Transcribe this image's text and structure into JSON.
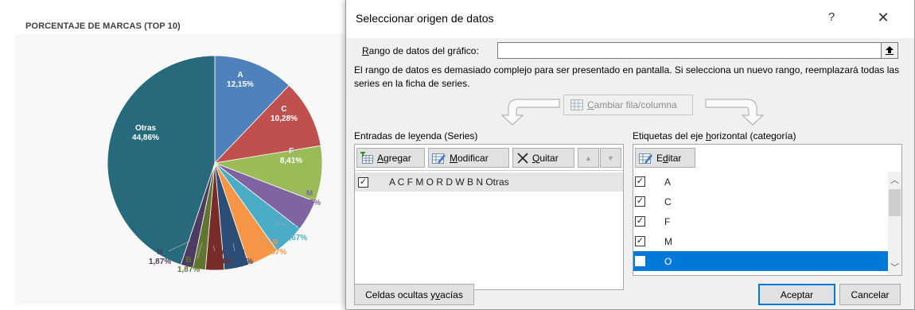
{
  "chart_data": {
    "type": "pie",
    "title": "PORCENTAJE DE MARCAS  (TOP 10)",
    "slices": [
      {
        "label": "A",
        "pct": "12,15%",
        "value": 12.15,
        "color": "#4f81bd",
        "label_color": "#ffffff"
      },
      {
        "label": "C",
        "pct": "10,28%",
        "value": 10.28,
        "color": "#c0504d",
        "label_color": "#ffffff"
      },
      {
        "label": "F",
        "pct": "8,41%",
        "value": 8.41,
        "color": "#9bbb59",
        "label_color": "#ffffff"
      },
      {
        "label": "M",
        "pct": "4,67%",
        "value": 4.67,
        "color": "#8064a2",
        "label_color": "#8064a2"
      },
      {
        "label": "O",
        "pct": "4,67%",
        "value": 4.67,
        "color": "#4bacc6",
        "label_color": "#4bacc6"
      },
      {
        "label": "R",
        "pct": "4,67%",
        "value": 4.67,
        "color": "#f79646",
        "label_color": "#f79646"
      },
      {
        "label": "D",
        "pct": "3,74%",
        "value": 3.74,
        "color": "#2c4d75",
        "label_color": "#2c4d75"
      },
      {
        "label": "W",
        "pct": "2,80%",
        "value": 2.8,
        "color": "#772c2a",
        "label_color": "#772c2a"
      },
      {
        "label": "B",
        "pct": "1,87%",
        "value": 1.87,
        "color": "#5f7530",
        "label_color": "#5f7530"
      },
      {
        "label": "N",
        "pct": "1,87%",
        "value": 1.87,
        "color": "#4d3b62",
        "label_color": "#4d3b62"
      },
      {
        "label": "Otras",
        "pct": "44,86%",
        "value": 44.86,
        "color": "#276a7c",
        "label_color": "#ffffff"
      }
    ]
  },
  "dialog": {
    "title": "Seleccionar origen de datos",
    "help_glyph": "?",
    "close_glyph": "✕",
    "range_label_pre": "",
    "range_label_u": "R",
    "range_label_post": "ango de datos del gráfico:",
    "range_value": "",
    "info_text": "El rango de datos es demasiado complejo para ser presentado en pantalla. Si selecciona un nuevo rango, reemplazará todas las series en la ficha de series.",
    "switch_pre": "",
    "switch_u": "C",
    "switch_post": "ambiar fila/columna",
    "series_label_pre": "Entradas de le",
    "series_label_u": "y",
    "series_label_post": "enda (Series)",
    "add_pre": "",
    "add_u": "A",
    "add_post": "gregar",
    "edit_pre": "",
    "edit_u": "M",
    "edit_post": "odificar",
    "remove_pre": "",
    "remove_u": "Q",
    "remove_post": "uitar",
    "up_glyph": "▲",
    "down_glyph": "▼",
    "series": [
      {
        "name": "A C F M O R D W B N Otras",
        "checked": true
      }
    ],
    "cat_label_pre": "Etiquetas del eje ",
    "cat_label_u": "h",
    "cat_label_post": "orizontal (categoría)",
    "cat_edit_pre": "E",
    "cat_edit_u": "d",
    "cat_edit_post": "itar",
    "categories": [
      {
        "name": "A",
        "checked": true
      },
      {
        "name": "C",
        "checked": true
      },
      {
        "name": "F",
        "checked": true
      },
      {
        "name": "M",
        "checked": true
      },
      {
        "name": "O",
        "checked": false,
        "selected": true
      }
    ],
    "hidden_pre": "Celdas ocultas y ",
    "hidden_u": "v",
    "hidden_post": "acías",
    "ok": "Aceptar",
    "cancel": "Cancelar"
  }
}
